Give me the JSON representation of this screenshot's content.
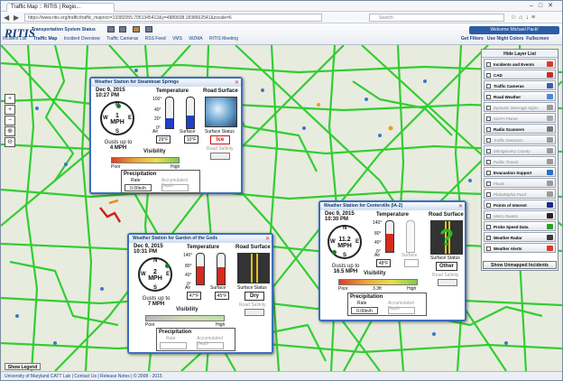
{
  "browser": {
    "tab_title": "Traffic Map :: RITIS | Regio...",
    "url": "https://www.ritis.org/traffic/traffic_map#zc=13382055.7051345412&y=4889938.1838662541&zscale=6",
    "search_placeholder": "Search"
  },
  "header": {
    "logo": "RITIS",
    "tss_link": "Transportation System Status",
    "welcome": "Welcome Michael Pack!",
    "nav": [
      "Incident List",
      "Traffic Map",
      "Incident Overview",
      "Traffic Cameras",
      "RSS Feed",
      "VMS",
      "WZMA",
      "RITIS Meeting"
    ],
    "right_links": [
      "Get Filters",
      "Use Night Colors",
      "Fullscreen"
    ]
  },
  "zoom": {
    "buttons": [
      "+",
      "+",
      "−",
      "⊕",
      "⊖",
      "⌂"
    ]
  },
  "layer_list": {
    "header": "Hide Layer List",
    "items": [
      {
        "label": "Incidents and Events",
        "style": "b",
        "color": "#d63b2a"
      },
      {
        "label": "CAD",
        "style": "b",
        "color": "#c52b2b"
      },
      {
        "label": "Traffic Cameras",
        "style": "b",
        "color": "#3a5fa8"
      },
      {
        "label": "Road Weather",
        "style": "b",
        "color": "#4a8ad0"
      },
      {
        "label": "Dynamic Message Signs",
        "style": "d",
        "color": "#9a9a9a"
      },
      {
        "label": "511PA Planet",
        "style": "d",
        "color": "#a7a7a7"
      },
      {
        "label": "Radio Scanners",
        "style": "b",
        "color": "#777777"
      },
      {
        "label": "Traffic Detectors",
        "style": "d",
        "color": "#9a9a9a"
      },
      {
        "label": "Montgomery County",
        "style": "d",
        "color": "#9a9a9a"
      },
      {
        "label": "Public Transit",
        "style": "d",
        "color": "#9a9a9a"
      },
      {
        "label": "Evacuation Support",
        "style": "b",
        "color": "#2a6fc9"
      },
      {
        "label": "Floats",
        "style": "d",
        "color": "#9a9a9a"
      },
      {
        "label": "Philadelphia Pusd",
        "style": "d",
        "color": "#9a9a9a"
      },
      {
        "label": "Points of Interest",
        "style": "b",
        "color": "#1a2a8a"
      },
      {
        "label": "Metro Routes",
        "style": "d",
        "color": "#222222"
      },
      {
        "label": "Probe Speed Data",
        "style": "b",
        "color": "#2aa02a"
      },
      {
        "label": "Weather Radar",
        "style": "b",
        "color": "#3a3a3a"
      },
      {
        "label": "Weather Alerts",
        "style": "b",
        "color": "#d63b2a"
      }
    ],
    "footer": "Show Unmapped Incidents"
  },
  "stations": [
    {
      "title": "Weather Station for Steamboat Springs",
      "date": "Dec 9, 2015",
      "time": "10:27 PM",
      "speed_value": "1",
      "speed_unit": "MPH",
      "gust_prefix": "Gusts up to",
      "gust": "4 MPH",
      "temp_label": "Temperature",
      "air_label": "Air",
      "air": "29°F",
      "air_fill": 0.32,
      "surface_label": "Surface",
      "surface": "10°F",
      "surface_fill": 0.42,
      "ticks": [
        "100°",
        "40°",
        "20°",
        "0°"
      ],
      "vis_label": "Visibility",
      "poor": "Poor",
      "high": "High",
      "road_label": "Road Surface",
      "status_label": "Surface Status",
      "status": "Ice",
      "salinity_label": "Road Salinity",
      "precip_label": "Precipitation",
      "rate_label": "Rate",
      "rate": "0.00in/h",
      "accum_label": "Accumulated Depth"
    },
    {
      "title": "Weather Station for Garden of the Gods",
      "date": "Dec 9, 2015",
      "time": "10:31 PM",
      "speed_value": "2",
      "speed_unit": "MPH",
      "gust_prefix": "Gusts up to",
      "gust": "7 MPH",
      "temp_label": "Temperature",
      "air_label": "Air",
      "air": "47°F",
      "air_fill": 0.6,
      "surface_label": "Surface",
      "surface": "45°F",
      "surface_fill": 0.57,
      "ticks": [
        "140°",
        "80°",
        "40°",
        "0°"
      ],
      "vis_label": "Visibility",
      "poor": "Poor",
      "high": "High",
      "road_label": "Road Surface",
      "status_label": "Surface Status",
      "status": "Dry",
      "salinity_label": "Road Salinity",
      "precip_label": "Precipitation",
      "rate_label": "Rate",
      "rate": "",
      "accum_label": "Accumulated Depth"
    },
    {
      "title": "Weather Station for Centerville (IA-2)",
      "date": "Dec 9, 2015",
      "time": "10:30 PM",
      "speed_value": "11.2",
      "speed_unit": "MPH",
      "gust_prefix": "Gusts up to",
      "gust": "16.5 MPH",
      "temp_label": "Temperature",
      "air_label": "Air",
      "air": "48°F",
      "air_fill": 0.6,
      "surface_label": "Surface",
      "surface": "",
      "surface_fill": 0,
      "ticks": [
        "140°",
        "80°",
        "40°",
        "0°"
      ],
      "vis_label": "Visibility",
      "vis_value": "3.3ft",
      "poor": "Poor",
      "high": "High",
      "road_label": "Road Surface",
      "status_label": "Surface Status",
      "status": "Other",
      "salinity_label": "Road Salinity",
      "precip_label": "Precipitation",
      "rate_label": "Rate",
      "rate": "0.00in/h",
      "accum_label": "Accumulated Depth"
    }
  ],
  "footer": {
    "show_legend": "Show Legend",
    "links": "University of Maryland CATT Lab | Contact Us | Release Notes | © 2008 - 2015"
  },
  "colors": {
    "road_green": "#2ecc2e",
    "road_red": "#d32020",
    "accent": "#2b5da6"
  }
}
